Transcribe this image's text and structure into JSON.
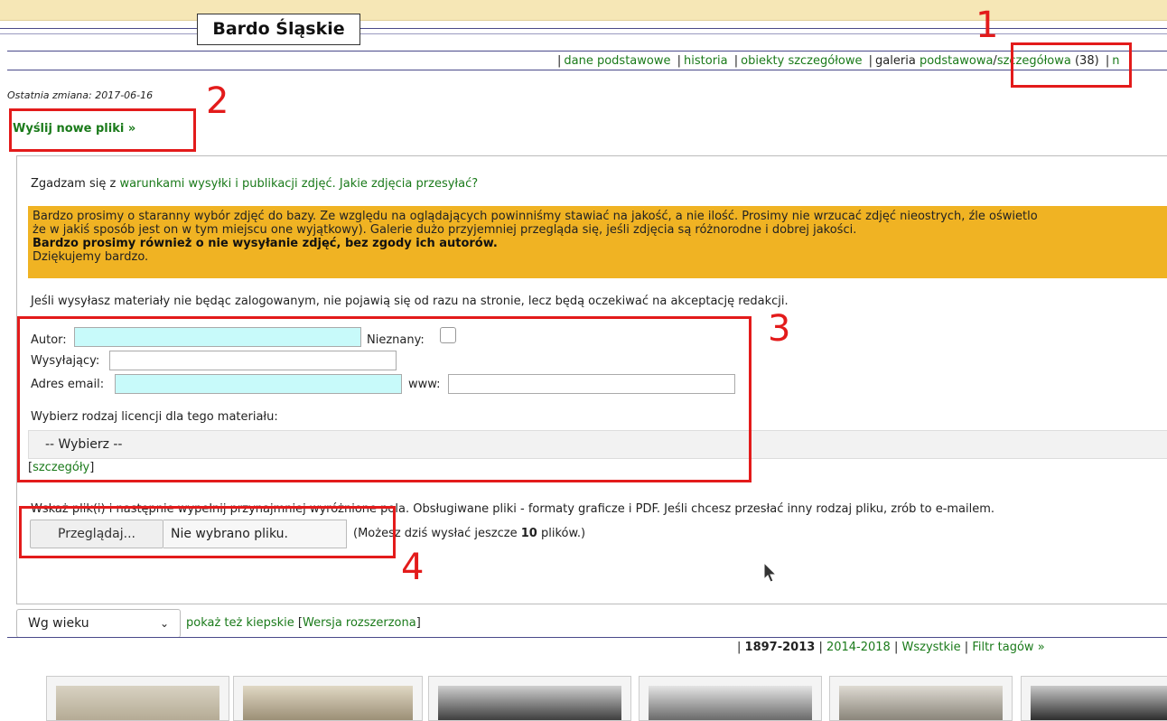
{
  "page": {
    "title": "Bardo Śląskie",
    "last_modified": "Ostatnia zmiana: 2017-06-16",
    "upload_link": "Wyślij nowe pliki »"
  },
  "nav": {
    "items": [
      "dane podstawowe",
      "historia",
      "obiekty szczegółowe"
    ],
    "gallery_label": "galeria",
    "gallery_basic": "podstawowa",
    "gallery_slash": "/",
    "gallery_detailed": "szczegółowa",
    "gallery_count": "(38)",
    "more": "n"
  },
  "form": {
    "agree_text": "Zgadzam się z",
    "agree_link": "warunkami wysyłki i publikacji zdjęć.",
    "what_link": "Jakie zdjęcia przesyłać?",
    "notice_line1": "Bardzo prosimy o staranny wybór zdjęć do bazy. Ze względu na oglądających powinniśmy stawiać na jakość, a nie ilość. Prosimy nie wrzucać zdjęć nieostrych, źle oświetlo",
    "notice_line2": "że w jakiś sposób jest on w tym miejscu one wyjątkowy). Galerie dużo przyjemniej przegląda się, jeśli zdjęcia są różnorodne i dobrej jakości.",
    "notice_bold": "Bardzo prosimy również o nie wysyłanie zdjęć, bez zgody ich autorów.",
    "notice_thanks": "Dziękujemy bardzo.",
    "login_msg": "Jeśli wysyłasz materiały nie będąc zalogowanym, nie pojawią się od razu na stronie, lecz będą oczekiwać na akceptację redakcji.",
    "author_label": "Autor:",
    "author_value": "",
    "unknown_label": "Nieznany:",
    "sender_label": "Wysyłający:",
    "sender_value": "",
    "email_label": "Adres email:",
    "email_value": "",
    "www_label": "www:",
    "www_value": "",
    "license_label": "Wybierz rodzaj licencji dla tego materiału:",
    "license_selected": "-- Wybierz --",
    "details_open": "[",
    "details_link": "szczegóły",
    "details_close": "]",
    "file_instructions": "Wskaż plik(i) i następnie wypełnij przynajmniej wyróżnione pola. Obsługiwane pliki - formaty graficze i PDF. Jeśli chcesz przesłać inny rodzaj pliku, zrób to e-mailem.",
    "browse_label": "Przeglądaj...",
    "file_status": "Nie wybrano pliku.",
    "remaining_pre": "(Możesz dziś wysłać jeszcze",
    "remaining_count": "10",
    "remaining_post": "plików.)"
  },
  "gallery": {
    "sort_selected": "Wg wieku",
    "show_bad_link": "pokaż też kiepskie",
    "extended_open": "[",
    "extended_link": "Wersja rozszerzona",
    "extended_close": "]",
    "years_active": "1897-2013",
    "years_link": "2014-2018",
    "all_link": "Wszystkie",
    "tag_filter": "Filtr tagów »"
  },
  "annotations": [
    "1",
    "2",
    "3",
    "4"
  ],
  "colors": {
    "accent_link": "#1a7a1a",
    "notice_bg": "#f0b323",
    "highlight_input": "#c8fafa",
    "annotation": "#e31b1b",
    "top_bar": "#f6e7b6"
  }
}
